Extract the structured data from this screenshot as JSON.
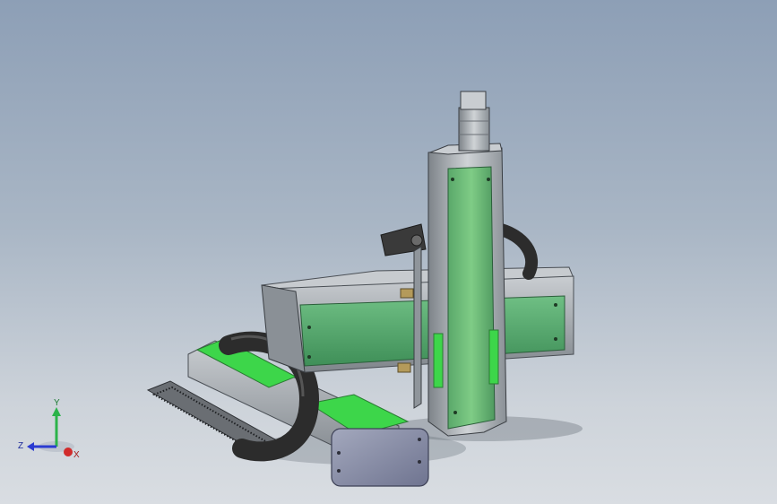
{
  "viewport": {
    "background_top": "#8d9fb6",
    "background_bottom": "#d9dde2"
  },
  "model": {
    "accent_green": "#4fa86a",
    "bright_green": "#3dd64a",
    "metal_gray": "#9ea3a8",
    "dark_gray": "#3a3a3a",
    "cover_blue_gray": "#8a8fa8",
    "bracket_tan": "#b49a5a"
  },
  "triad": {
    "x_label": "X",
    "y_label": "Y",
    "z_label": "Z",
    "x_color": "#d12b2b",
    "y_color": "#2bb34a",
    "z_color": "#2b3bd1"
  }
}
